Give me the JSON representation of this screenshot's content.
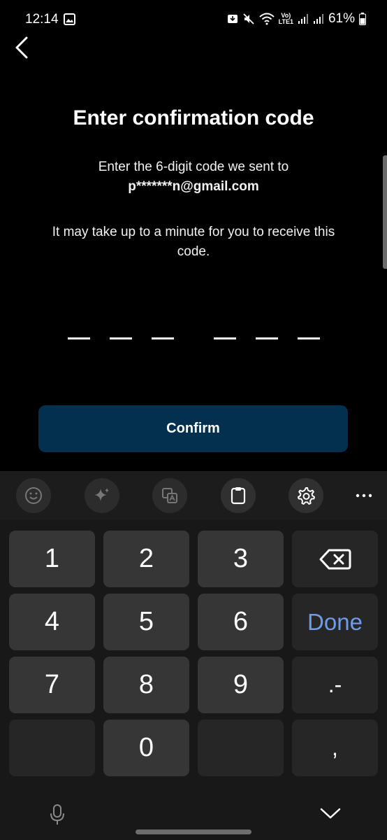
{
  "status_bar": {
    "time": "12:14",
    "network": "LTE1",
    "battery": "61%"
  },
  "screen": {
    "title": "Enter confirmation code",
    "subtitle": "Enter the 6-digit code we sent to",
    "email": "p*******n@gmail.com",
    "note": "It may take up to a minute for you to receive this code.",
    "code_length": 6,
    "confirm_label": "Confirm"
  },
  "colors": {
    "background": "#000000",
    "confirm_button": "#03304f",
    "keyboard": "#181818",
    "key": "#363636",
    "done_text": "#6f9ce8"
  },
  "keyboard": {
    "toolbar_icons": [
      "emoji-icon",
      "sparkle-icon",
      "translate-icon",
      "clipboard-icon",
      "settings-icon",
      "more-icon"
    ],
    "keys": {
      "k1": "1",
      "k2": "2",
      "k3": "3",
      "k4": "4",
      "k5": "5",
      "k6": "6",
      "k7": "7",
      "k8": "8",
      "k9": "9",
      "k0": "0",
      "done": "Done",
      "dot_dash": ".-",
      "comma": ","
    }
  }
}
